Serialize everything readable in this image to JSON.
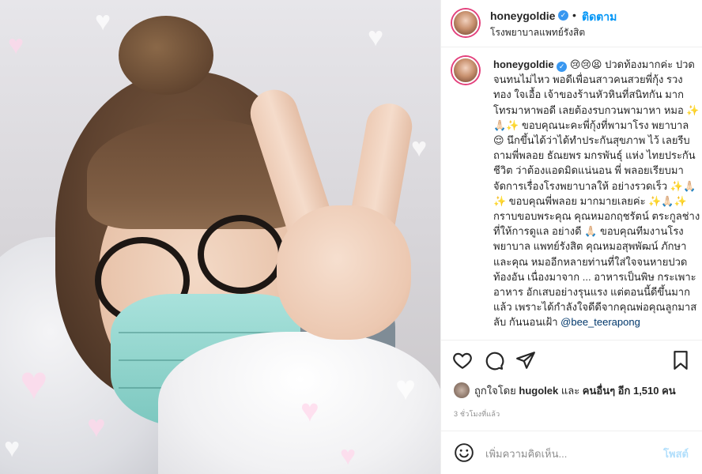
{
  "post": {
    "username": "honeygoldie",
    "verified_icon": "verified-badge-icon",
    "separator": "•",
    "follow_label": "ติดตาม",
    "location": "โรงพยาบาลแพทย์รังสิต"
  },
  "caption": {
    "username": "honeygoldie",
    "text": "😢😢😫 ปวดท้องมากค่ะ ปวดจนทนไม่ไหว พอดีเพื่อนสาวคนสวยพี่กุ้ง รวงทอง ใจเอื้อ เจ้าของร้านหัวหินที่สนิทกัน มากโทรมาหาพอดี เลยต้องรบกวนพามาหา หมอ ✨🙏🏻✨ ขอบคุณนะคะพี่กุ้งที่พามาโรง พยาบาล 😌 นึกขึ้นได้ว่าได้ทำประกันสุขภาพ ไว้ เลยรีบถามพี่พลอย ธัณยพร มกรพันธุ์ แห่ง ไทยประกันชีวิต ว่าต้องแอดมิดแน่นอน พี่ พลอยเรียบมาจัดการเรื่องโรงพยาบาลให้ อย่างรวดเร็ว ✨🙏🏻✨ ขอบคุณพี่พลอย มากมายเลยค่ะ ✨🙏🏻✨ กราบขอบพระคุณ คุณหมอกฤชรัตน์ ตระกูลช่าง ที่ให้การดูแล อย่างดี 🙏🏻 ขอบคุณทีมงานโรงพยาบาล แพทย์รังสิต คุณหมอสุพพัฒน์ ภักษา และคุณ หมออีกหลายท่านที่ใส่ใจจนหายปวดท้องอัน เนื่องมาจาก ... อาหารเป็นพิษ กระเพาะอาหาร อักเสบอย่างรุนแรง แต่ตอนนี้ดีขึ้นมากแล้ว เพราะได้กำลังใจดีดีจากคุณพ่อคุณลูกมาสลับ กันนอนเฝ้า",
    "mention": "@bee_teerapong"
  },
  "actions": {
    "like_icon": "heart-icon",
    "comment_icon": "comment-icon",
    "share_icon": "share-icon",
    "save_icon": "bookmark-icon"
  },
  "likes": {
    "prefix": "ถูกใจโดย",
    "user": "hugolek",
    "middle": "และ",
    "others": "คนอื่นๆ อีก 1,510 คน"
  },
  "timestamp": "3 ชั่วโมงที่แล้ว",
  "comment": {
    "placeholder": "เพิ่มความคิดเห็น...",
    "post_label": "โพสต์",
    "emoji_icon": "smiley-icon"
  },
  "colors": {
    "accent": "#0095f6",
    "post_disabled": "#b2dffc",
    "verified": "#3897f0"
  }
}
